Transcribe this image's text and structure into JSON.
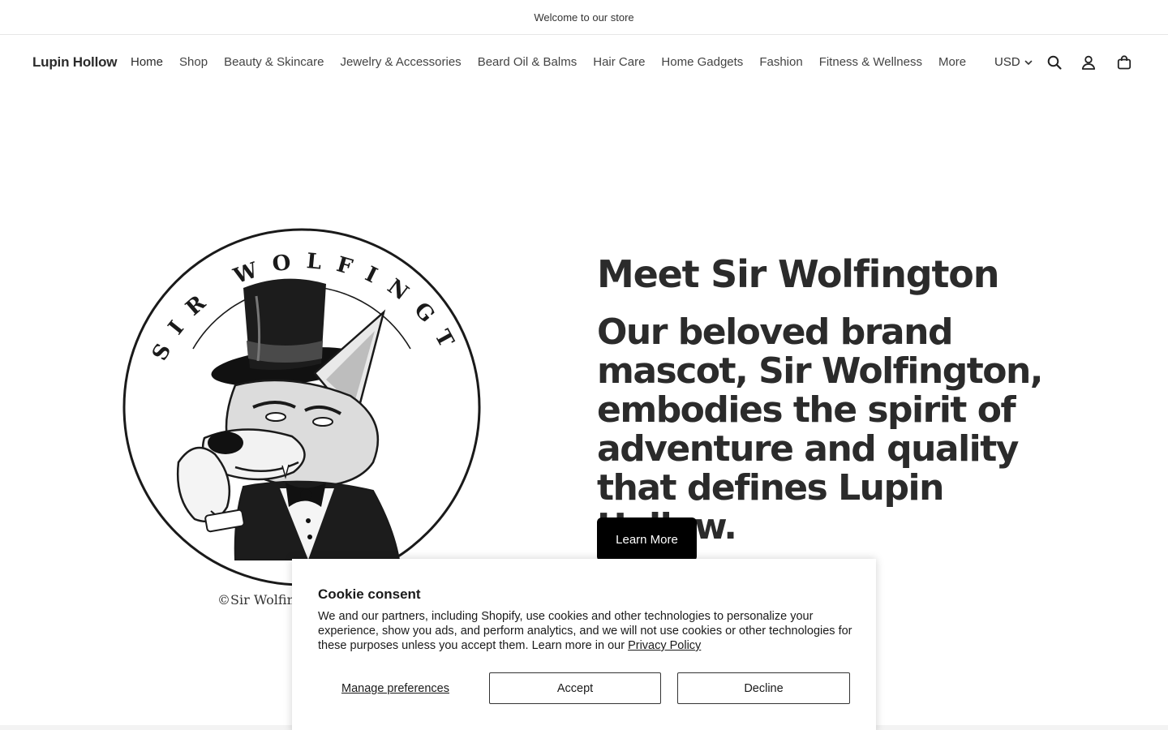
{
  "announcement": {
    "text": "Welcome to our store"
  },
  "header": {
    "logo": "Lupin Hollow",
    "nav": [
      "Home",
      "Shop",
      "Beauty & Skincare",
      "Jewelry & Accessories",
      "Beard Oil & Balms",
      "Hair Care",
      "Home Gadgets",
      "Fashion",
      "Fitness & Wellness",
      "More"
    ],
    "currency": "USD",
    "icons": [
      "search-icon",
      "account-icon",
      "cart-icon"
    ]
  },
  "hero": {
    "logo_image": {
      "arc_text": "SIR WOLFINGTON",
      "copyright": "©Sir Wolfington"
    },
    "title": "Meet Sir Wolfington",
    "subtitle": "Our beloved brand mascot, Sir Wolfington, embodies the spirit of adventure and quality that defines Lupin Hollow.",
    "button": "Learn More"
  },
  "cookie": {
    "title": "Cookie consent",
    "body": "We and our partners, including Shopify, use cookies and other technologies to personalize your experience, show you ads, and perform analytics, and we will not use cookies or other technologies for these purposes unless you accept them. Learn more in our",
    "link": "Privacy Policy",
    "manage": "Manage preferences",
    "accept": "Accept",
    "decline": "Decline"
  }
}
